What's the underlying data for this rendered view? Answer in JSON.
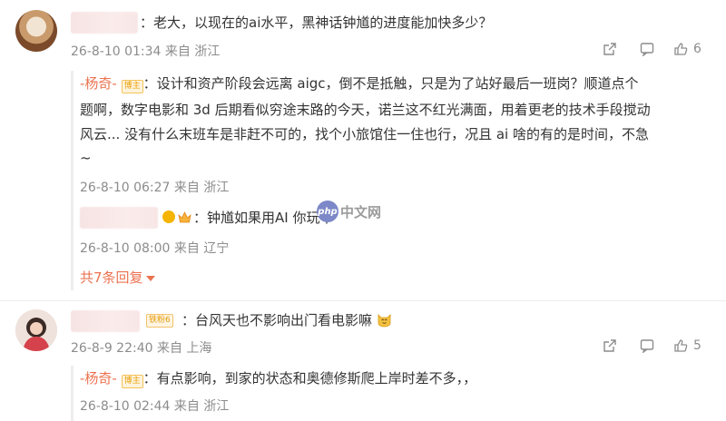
{
  "comments": [
    {
      "text": "：老大，以现在的ai水平，黑神话钟馗的进度能加快多少？",
      "time": "26-8-10 01:34",
      "location": "来自 浙江",
      "likes": "6"
    },
    {
      "text": "：台风天也不影响出门看电影嘛",
      "badge": "铁粉6",
      "time": "26-8-9 22:40",
      "location": "来自 上海",
      "likes": "5"
    }
  ],
  "replies": [
    {
      "author": "-杨奇-",
      "badge": "博主",
      "lines": [
        "：设计和资产阶段会远离 aigc，倒不是抵触，只是为了站好最后一班岗？顺道点个",
        "题啊，数字电影和 3d 后期看似穷途末路的今天，诺兰这不红光满面，用着更老的技术手段搅动",
        "风云... 没有什么末班车是非赶不可的，找个小旅馆住一住也行，况且 ai 啥的有的是时间，不急",
        "~"
      ],
      "time": "26-8-10 06:27",
      "location": "来自 浙江"
    },
    {
      "text": "：钟馗如果用AI 你玩不",
      "time": "26-8-10 08:00",
      "location": "来自 辽宁"
    },
    {
      "author": "-杨奇-",
      "badge": "博主",
      "text": "：有点影响，到家的状态和奥德修斯爬上岸时差不多，，",
      "time": "26-8-10 02:44",
      "location": "来自 浙江"
    }
  ],
  "more_replies": "共7条回复",
  "watermark": {
    "logo": "php",
    "text": "中文网"
  },
  "colors": {
    "accent": "#eb7350",
    "meta": "#8c8c8c"
  }
}
